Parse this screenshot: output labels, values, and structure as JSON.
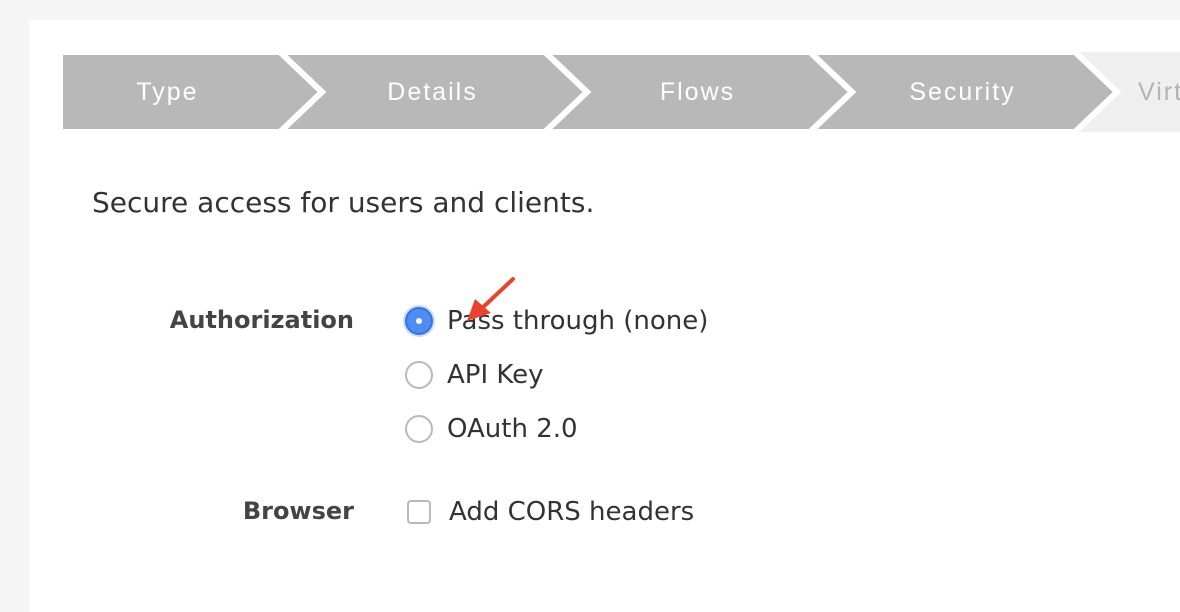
{
  "wizard": {
    "steps": [
      {
        "label": "Type",
        "state": "complete"
      },
      {
        "label": "Details",
        "state": "complete"
      },
      {
        "label": "Flows",
        "state": "complete"
      },
      {
        "label": "Security",
        "state": "current"
      },
      {
        "label": "Virt",
        "state": "future"
      }
    ],
    "colors": {
      "done": "#b8b8b8",
      "future": "#efefef",
      "separator": "#ffffff"
    }
  },
  "intro": "Secure access for users and clients.",
  "authorization": {
    "label": "Authorization",
    "options": [
      {
        "label": "Pass through (none)",
        "selected": true
      },
      {
        "label": "API Key",
        "selected": false
      },
      {
        "label": "OAuth 2.0",
        "selected": false
      }
    ]
  },
  "browser": {
    "label": "Browser",
    "cors_label": "Add CORS headers",
    "cors_checked": false
  },
  "annotation": {
    "icon": "red-arrow-icon",
    "color": "#e8432e"
  }
}
